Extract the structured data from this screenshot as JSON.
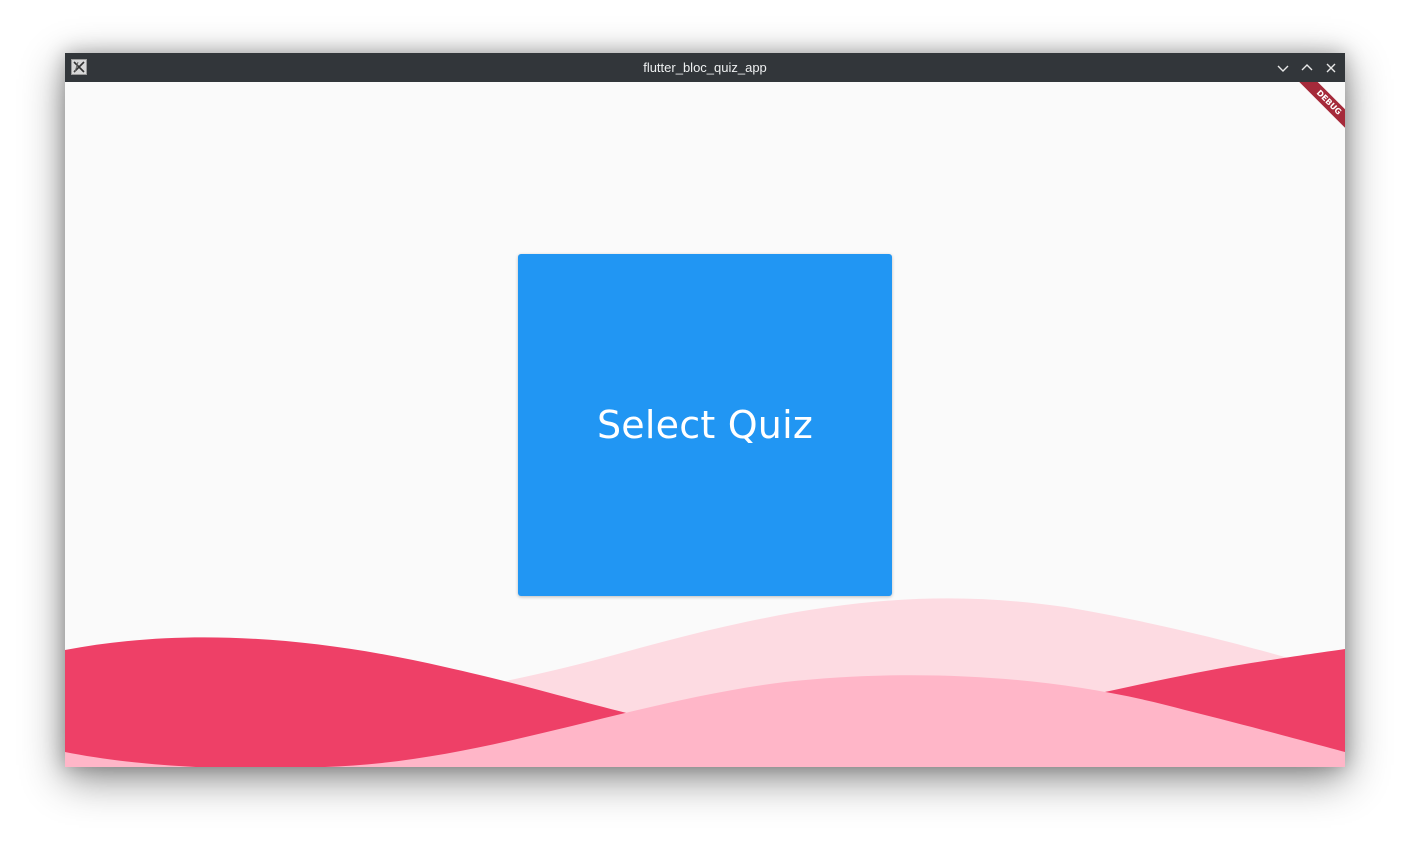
{
  "window": {
    "title": "flutter_bloc_quiz_app",
    "app_icon": "x11-app-icon",
    "controls": [
      "minimize-icon",
      "maximize-icon",
      "close-icon"
    ]
  },
  "main": {
    "button_label": "Select Quiz",
    "debug_banner": "DEBUG"
  },
  "colors": {
    "background": "#fafafa",
    "titlebar": "#32363a",
    "button": "#2196f3",
    "wave_light": "#fddbe2",
    "wave_mid": "#ffb6c8",
    "wave_dark": "#ee4067",
    "debug_banner": "#a52a3a"
  }
}
